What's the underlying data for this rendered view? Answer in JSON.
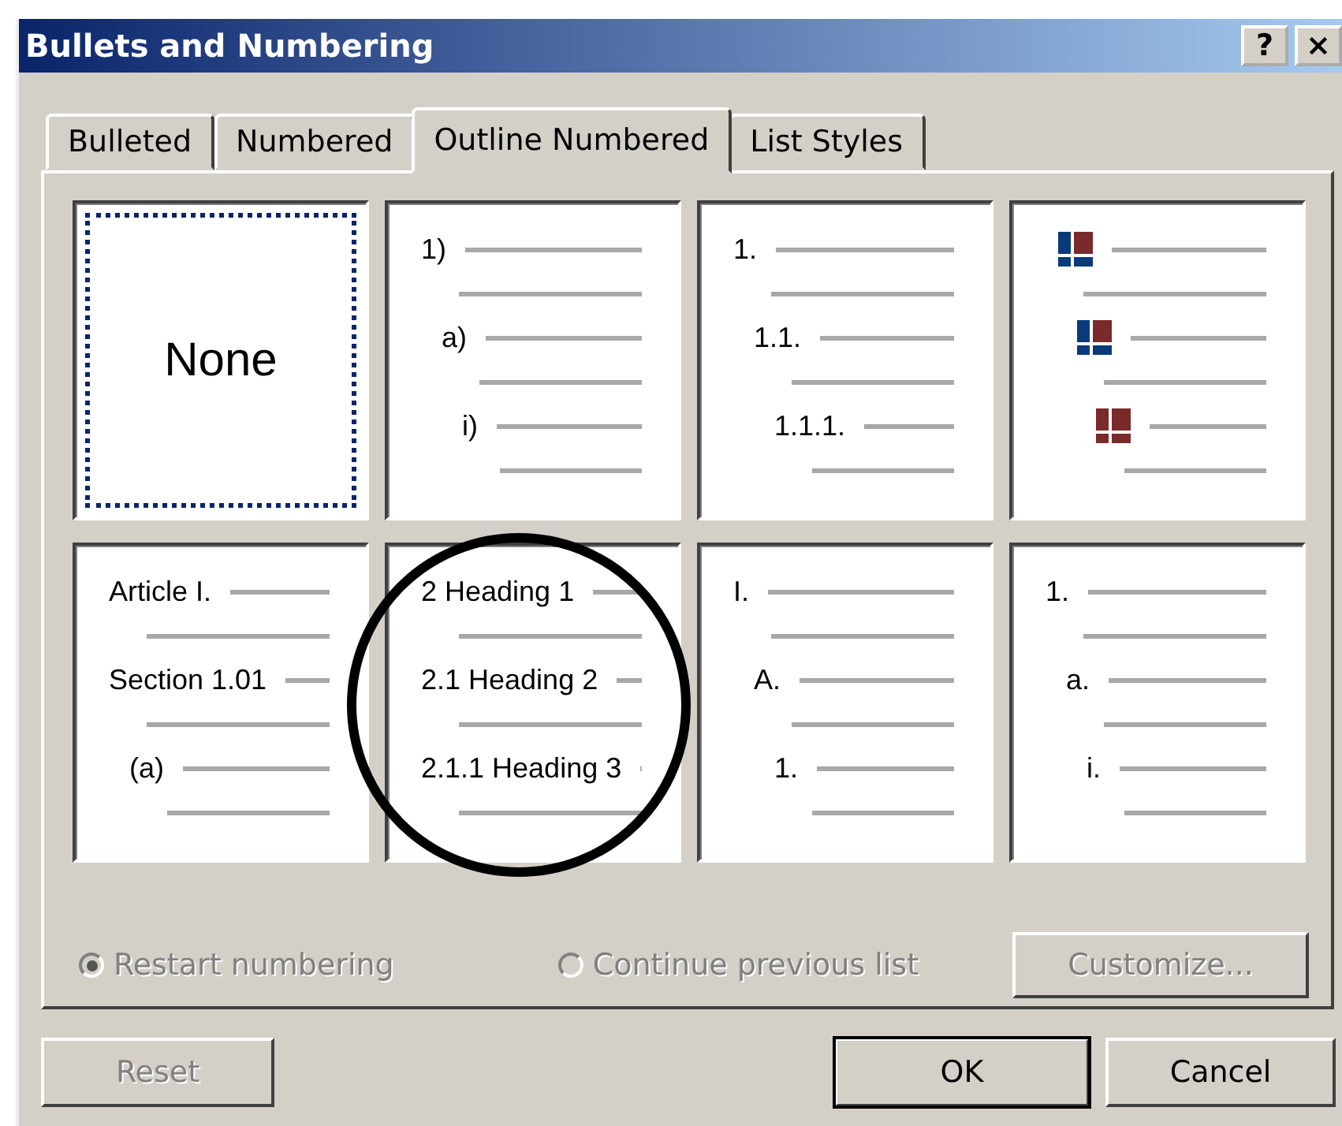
{
  "window": {
    "title": "Bullets and Numbering",
    "help_button": "?",
    "close_button": "×"
  },
  "tabs": [
    {
      "label": "Bulleted",
      "selected": false
    },
    {
      "label": "Numbered",
      "selected": false
    },
    {
      "label": "Outline Numbered",
      "selected": true
    },
    {
      "label": "List Styles",
      "selected": false
    }
  ],
  "gallery": [
    {
      "kind": "none",
      "label": "None",
      "selected": true,
      "circled": false
    },
    {
      "kind": "numbered",
      "selected": false,
      "circled": false,
      "levels": [
        {
          "number": "1)",
          "children": [
            {
              "number": "a)",
              "children": [
                {
                  "number": "i)"
                }
              ]
            }
          ]
        }
      ]
    },
    {
      "kind": "numbered",
      "selected": false,
      "circled": false,
      "levels": [
        {
          "number": "1.",
          "children": [
            {
              "number": "1.1.",
              "children": [
                {
                  "number": "1.1.1."
                }
              ]
            }
          ]
        }
      ]
    },
    {
      "kind": "bulleted",
      "selected": false,
      "circled": false,
      "levels": [
        {
          "kind": "square",
          "children": [
            {
              "kind": "square",
              "children": [
                {
                  "kind": "square"
                }
              ]
            }
          ]
        }
      ]
    },
    {
      "kind": "numbered",
      "selected": false,
      "circled": false,
      "levels": [
        {
          "number": "Article I."
        },
        {
          "number": "Section 1.01",
          "children": [
            {
              "number": "(a)"
            }
          ]
        }
      ]
    },
    {
      "kind": "numbered",
      "selected": false,
      "circled": true,
      "levels": [
        {
          "number": "2 Heading 1"
        },
        {
          "number": "2.1 Heading 2"
        },
        {
          "number": "2.1.1 Heading 3"
        }
      ]
    },
    {
      "kind": "numbered",
      "selected": false,
      "circled": false,
      "levels": [
        {
          "number": "I.",
          "children": [
            {
              "number": "A.",
              "children": [
                {
                  "number": "1."
                }
              ]
            }
          ]
        }
      ]
    },
    {
      "kind": "numbered",
      "selected": false,
      "circled": false,
      "levels": [
        {
          "number": "1.",
          "children": [
            {
              "number": "a.",
              "children": [
                {
                  "number": "i."
                }
              ]
            }
          ]
        }
      ]
    }
  ],
  "numbering_options": [
    {
      "label": "Restart numbering",
      "selected": true,
      "disabled": true
    },
    {
      "label": "Continue previous list",
      "selected": false,
      "disabled": true
    }
  ],
  "customize_button": {
    "label": "Customize...",
    "disabled": true
  },
  "buttons": [
    {
      "label": "Reset",
      "disabled": true,
      "default": false
    },
    {
      "label": "OK",
      "disabled": false,
      "default": true
    },
    {
      "label": "Cancel",
      "disabled": false,
      "default": false
    }
  ]
}
